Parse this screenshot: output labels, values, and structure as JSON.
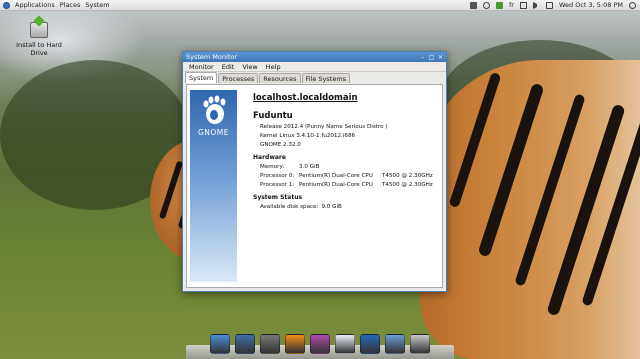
{
  "top_panel": {
    "menus": [
      "Applications",
      "Places",
      "System"
    ],
    "tray_text": "fr",
    "clock": "Wed Oct 3, 5:08 PM"
  },
  "desktop": {
    "icons": [
      {
        "label": "Install to Hard Drive"
      }
    ]
  },
  "window": {
    "title": "System Monitor",
    "menu": [
      "Monitor",
      "Edit",
      "View",
      "Help"
    ],
    "tabs": [
      "System",
      "Processes",
      "Resources",
      "File Systems"
    ],
    "active_tab": "System",
    "logo_text": "GNOME",
    "hostname": "localhost.localdomain",
    "distro": "Fuduntu",
    "release": "Release 2012.4 (Punny Name Serious Distro )",
    "kernel": "Kernel Linux 3.4.10-1.fu2012.i686",
    "gnome": "GNOME 2.32.0",
    "hardware": {
      "heading": "Hardware",
      "memory_label": "Memory:",
      "memory_value": "3.0 GiB",
      "cpu0_label": "Processor 0:",
      "cpu0_model": "Pentium(R) Dual-Core CPU",
      "cpu0_speed": "T4500  @ 2.30GHz",
      "cpu1_label": "Processor 1:",
      "cpu1_model": "Pentium(R) Dual-Core CPU",
      "cpu1_speed": "T4500  @ 2.30GHz"
    },
    "status": {
      "heading": "System Status",
      "disk_label": "Available disk space:",
      "disk_value": "9.0 GiB"
    }
  },
  "dock": {
    "items": [
      {
        "icon": "chrome-icon",
        "color": "#4a8fd8"
      },
      {
        "icon": "mail-stamp-icon",
        "color": "#3d6fa8"
      },
      {
        "icon": "settings-icon",
        "color": "#777777"
      },
      {
        "icon": "vlc-icon",
        "color": "#f08c1a"
      },
      {
        "icon": "music-icon",
        "color": "#b04aa8"
      },
      {
        "icon": "document-icon",
        "color": "#e8eef6"
      },
      {
        "icon": "system-monitor-icon",
        "color": "#2a66b8"
      },
      {
        "icon": "folder-icon",
        "color": "#6aa0d8"
      },
      {
        "icon": "trash-icon",
        "color": "#c8c8c8"
      }
    ]
  }
}
